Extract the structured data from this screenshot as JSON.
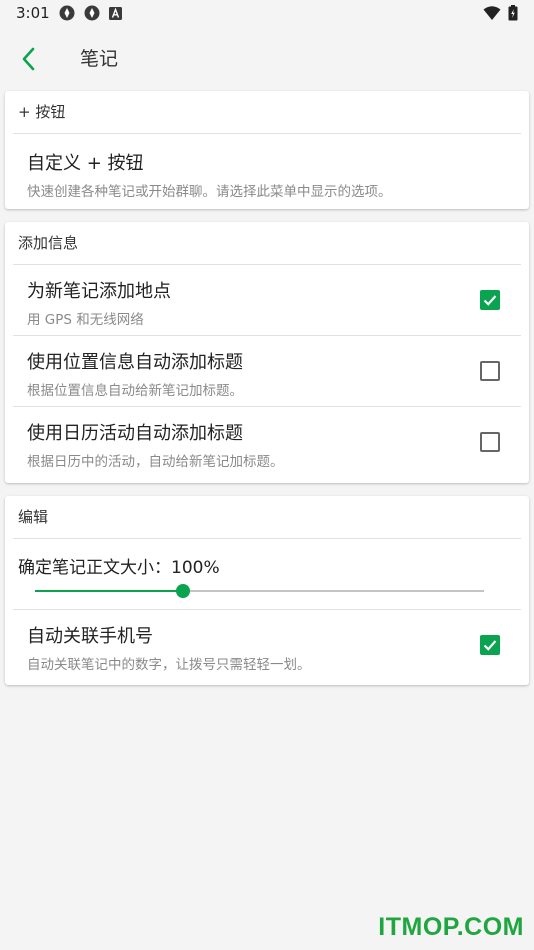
{
  "status_bar": {
    "time": "3:01"
  },
  "header": {
    "title": "笔记"
  },
  "section_button": {
    "header": "+ 按钮",
    "item": {
      "title": "自定义 + 按钮",
      "subtitle": "快速创建各种笔记或开始群聊。请选择此菜单中显示的选项。"
    }
  },
  "section_info": {
    "header": "添加信息",
    "items": [
      {
        "title": "为新笔记添加地点",
        "subtitle": "用 GPS 和无线网络",
        "checked": true
      },
      {
        "title": "使用位置信息自动添加标题",
        "subtitle": "根据位置信息自动给新笔记加标题。",
        "checked": false
      },
      {
        "title": "使用日历活动自动添加标题",
        "subtitle": "根据日历中的活动，自动给新笔记加标题。",
        "checked": false
      }
    ]
  },
  "section_edit": {
    "header": "编辑",
    "slider": {
      "label": "确定笔记正文大小：100%",
      "value_fraction": 0.33
    },
    "item": {
      "title": "自动关联手机号",
      "subtitle": "自动关联笔记中的数字，让拨号只需轻轻一划。",
      "checked": true
    }
  },
  "watermark": "ITMOP.COM",
  "colors": {
    "accent": "#0aa34f",
    "background": "#f4f4f4"
  }
}
